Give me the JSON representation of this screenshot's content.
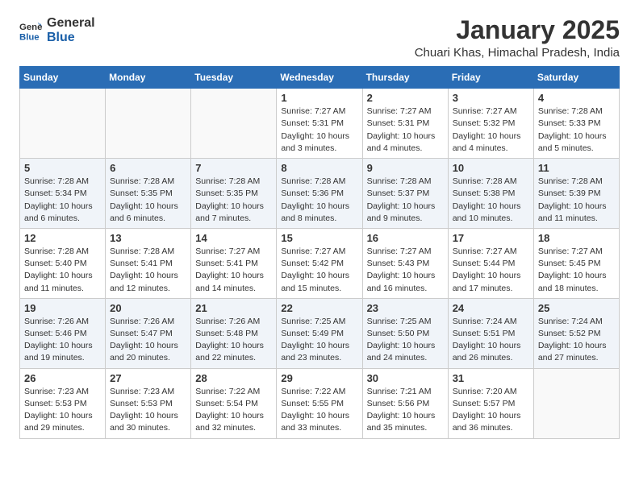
{
  "header": {
    "logo_line1": "General",
    "logo_line2": "Blue",
    "month": "January 2025",
    "location": "Chuari Khas, Himachal Pradesh, India"
  },
  "weekdays": [
    "Sunday",
    "Monday",
    "Tuesday",
    "Wednesday",
    "Thursday",
    "Friday",
    "Saturday"
  ],
  "weeks": [
    [
      {
        "day": "",
        "info": ""
      },
      {
        "day": "",
        "info": ""
      },
      {
        "day": "",
        "info": ""
      },
      {
        "day": "1",
        "info": "Sunrise: 7:27 AM\nSunset: 5:31 PM\nDaylight: 10 hours\nand 3 minutes."
      },
      {
        "day": "2",
        "info": "Sunrise: 7:27 AM\nSunset: 5:31 PM\nDaylight: 10 hours\nand 4 minutes."
      },
      {
        "day": "3",
        "info": "Sunrise: 7:27 AM\nSunset: 5:32 PM\nDaylight: 10 hours\nand 4 minutes."
      },
      {
        "day": "4",
        "info": "Sunrise: 7:28 AM\nSunset: 5:33 PM\nDaylight: 10 hours\nand 5 minutes."
      }
    ],
    [
      {
        "day": "5",
        "info": "Sunrise: 7:28 AM\nSunset: 5:34 PM\nDaylight: 10 hours\nand 6 minutes."
      },
      {
        "day": "6",
        "info": "Sunrise: 7:28 AM\nSunset: 5:35 PM\nDaylight: 10 hours\nand 6 minutes."
      },
      {
        "day": "7",
        "info": "Sunrise: 7:28 AM\nSunset: 5:35 PM\nDaylight: 10 hours\nand 7 minutes."
      },
      {
        "day": "8",
        "info": "Sunrise: 7:28 AM\nSunset: 5:36 PM\nDaylight: 10 hours\nand 8 minutes."
      },
      {
        "day": "9",
        "info": "Sunrise: 7:28 AM\nSunset: 5:37 PM\nDaylight: 10 hours\nand 9 minutes."
      },
      {
        "day": "10",
        "info": "Sunrise: 7:28 AM\nSunset: 5:38 PM\nDaylight: 10 hours\nand 10 minutes."
      },
      {
        "day": "11",
        "info": "Sunrise: 7:28 AM\nSunset: 5:39 PM\nDaylight: 10 hours\nand 11 minutes."
      }
    ],
    [
      {
        "day": "12",
        "info": "Sunrise: 7:28 AM\nSunset: 5:40 PM\nDaylight: 10 hours\nand 11 minutes."
      },
      {
        "day": "13",
        "info": "Sunrise: 7:28 AM\nSunset: 5:41 PM\nDaylight: 10 hours\nand 12 minutes."
      },
      {
        "day": "14",
        "info": "Sunrise: 7:27 AM\nSunset: 5:41 PM\nDaylight: 10 hours\nand 14 minutes."
      },
      {
        "day": "15",
        "info": "Sunrise: 7:27 AM\nSunset: 5:42 PM\nDaylight: 10 hours\nand 15 minutes."
      },
      {
        "day": "16",
        "info": "Sunrise: 7:27 AM\nSunset: 5:43 PM\nDaylight: 10 hours\nand 16 minutes."
      },
      {
        "day": "17",
        "info": "Sunrise: 7:27 AM\nSunset: 5:44 PM\nDaylight: 10 hours\nand 17 minutes."
      },
      {
        "day": "18",
        "info": "Sunrise: 7:27 AM\nSunset: 5:45 PM\nDaylight: 10 hours\nand 18 minutes."
      }
    ],
    [
      {
        "day": "19",
        "info": "Sunrise: 7:26 AM\nSunset: 5:46 PM\nDaylight: 10 hours\nand 19 minutes."
      },
      {
        "day": "20",
        "info": "Sunrise: 7:26 AM\nSunset: 5:47 PM\nDaylight: 10 hours\nand 20 minutes."
      },
      {
        "day": "21",
        "info": "Sunrise: 7:26 AM\nSunset: 5:48 PM\nDaylight: 10 hours\nand 22 minutes."
      },
      {
        "day": "22",
        "info": "Sunrise: 7:25 AM\nSunset: 5:49 PM\nDaylight: 10 hours\nand 23 minutes."
      },
      {
        "day": "23",
        "info": "Sunrise: 7:25 AM\nSunset: 5:50 PM\nDaylight: 10 hours\nand 24 minutes."
      },
      {
        "day": "24",
        "info": "Sunrise: 7:24 AM\nSunset: 5:51 PM\nDaylight: 10 hours\nand 26 minutes."
      },
      {
        "day": "25",
        "info": "Sunrise: 7:24 AM\nSunset: 5:52 PM\nDaylight: 10 hours\nand 27 minutes."
      }
    ],
    [
      {
        "day": "26",
        "info": "Sunrise: 7:23 AM\nSunset: 5:53 PM\nDaylight: 10 hours\nand 29 minutes."
      },
      {
        "day": "27",
        "info": "Sunrise: 7:23 AM\nSunset: 5:53 PM\nDaylight: 10 hours\nand 30 minutes."
      },
      {
        "day": "28",
        "info": "Sunrise: 7:22 AM\nSunset: 5:54 PM\nDaylight: 10 hours\nand 32 minutes."
      },
      {
        "day": "29",
        "info": "Sunrise: 7:22 AM\nSunset: 5:55 PM\nDaylight: 10 hours\nand 33 minutes."
      },
      {
        "day": "30",
        "info": "Sunrise: 7:21 AM\nSunset: 5:56 PM\nDaylight: 10 hours\nand 35 minutes."
      },
      {
        "day": "31",
        "info": "Sunrise: 7:20 AM\nSunset: 5:57 PM\nDaylight: 10 hours\nand 36 minutes."
      },
      {
        "day": "",
        "info": ""
      }
    ]
  ]
}
